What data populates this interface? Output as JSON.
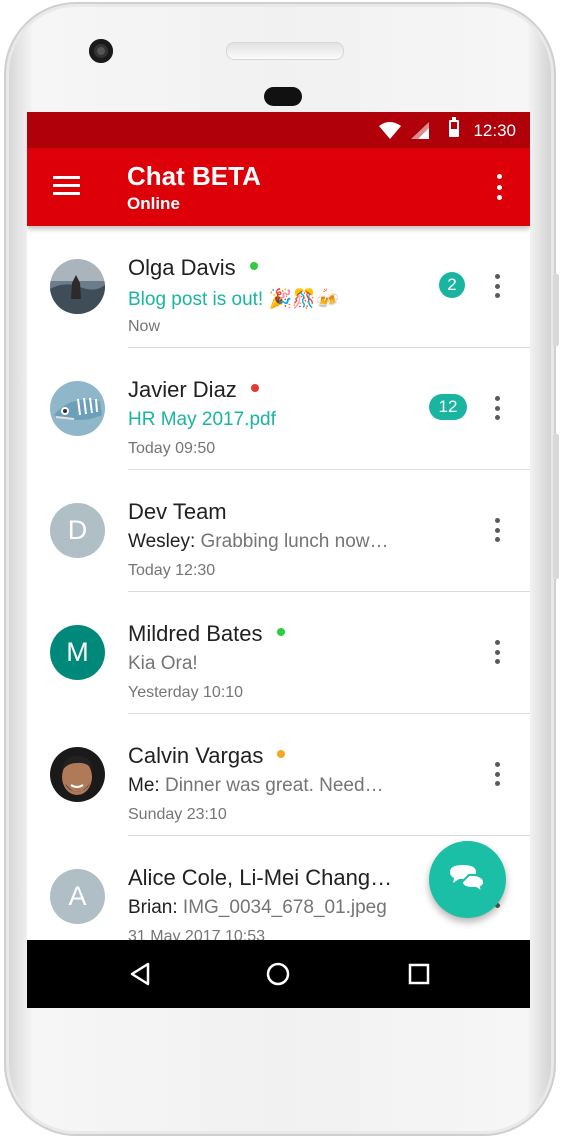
{
  "status_bar": {
    "time": "12:30",
    "icons": [
      "wifi-icon",
      "signal-icon",
      "battery-icon"
    ]
  },
  "app_bar": {
    "title": "Chat BETA",
    "subtitle": "Online",
    "menu_icon": "hamburger-icon",
    "more_icon": "more-vert-icon"
  },
  "colors": {
    "status_bar": "#b00009",
    "app_bar": "#dd0008",
    "accent": "#19b5a0",
    "online": "#2ecc40",
    "busy": "#e53935",
    "away": "#f5a623"
  },
  "chats": [
    {
      "name": "Olga Davis",
      "presence": "online",
      "preview": "Blog post is out!",
      "emoji": "🎉🎊🍻",
      "time": "Now",
      "unread": "2",
      "avatar": "photo"
    },
    {
      "name": "Javier Diaz",
      "presence": "busy",
      "preview": "HR May 2017.pdf",
      "time": "Today 09:50",
      "unread": "12",
      "avatar": "photo"
    },
    {
      "name": "Dev Team",
      "sender": "Wesley:",
      "preview": "Grabbing lunch now…",
      "time": "Today 12:30",
      "avatar_letter": "D",
      "avatar_color": "#b0bec5"
    },
    {
      "name": "Mildred Bates",
      "presence": "online",
      "preview": "Kia Ora!",
      "time": "Yesterday 10:10",
      "avatar_letter": "M",
      "avatar_color": "#00897b"
    },
    {
      "name": "Calvin Vargas",
      "presence": "away",
      "sender": "Me:",
      "preview": "Dinner was great. Need…",
      "time": "Sunday 23:10",
      "avatar": "photo"
    },
    {
      "name": "Alice Cole, Li-Mei Chang…",
      "sender": "Brian:",
      "preview": "IMG_0034_678_01.jpeg",
      "time": "31 May 2017 10:53",
      "avatar_letter": "A",
      "avatar_color": "#b0bec5"
    }
  ],
  "fab": {
    "icon": "chat-bubbles-icon"
  },
  "nav_bar": {
    "icons": [
      "back-icon",
      "home-icon",
      "recents-icon"
    ]
  }
}
